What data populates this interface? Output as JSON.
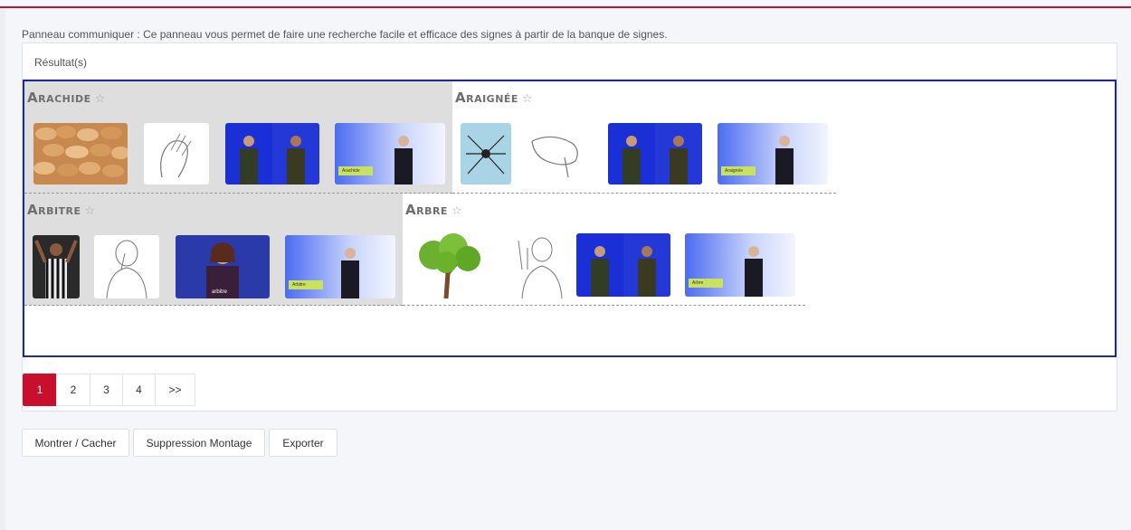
{
  "description": "Panneau communiquer : Ce panneau vous permet de faire une recherche facile et efficace des signes à partir de la banque de signes.",
  "panel": {
    "header": "Résultat(s)"
  },
  "words": [
    {
      "title": "Arachide",
      "star": "☆",
      "video_caption": "Arachide",
      "highlighted": true
    },
    {
      "title": "Araignée",
      "star": "☆",
      "video_caption": "Araignée",
      "highlighted": false
    },
    {
      "title": "Arbitre",
      "star": "☆",
      "video_caption": "Arbitre",
      "photo_caption": "arbitre",
      "highlighted": true
    },
    {
      "title": "Arbre",
      "star": "☆",
      "video_caption": "Arbre",
      "highlighted": false
    }
  ],
  "pagination": {
    "pages": [
      "1",
      "2",
      "3",
      "4"
    ],
    "next": ">>",
    "active": "1"
  },
  "buttons": {
    "toggle": "Montrer / Cacher",
    "delete": "Suppression Montage",
    "export": "Exporter"
  },
  "colors": {
    "accent": "#c8102e",
    "results_border": "#1c2b8f",
    "video_blue": "#1a2fd6",
    "highlight": "#dedede"
  },
  "icons": [
    "star-icon"
  ]
}
